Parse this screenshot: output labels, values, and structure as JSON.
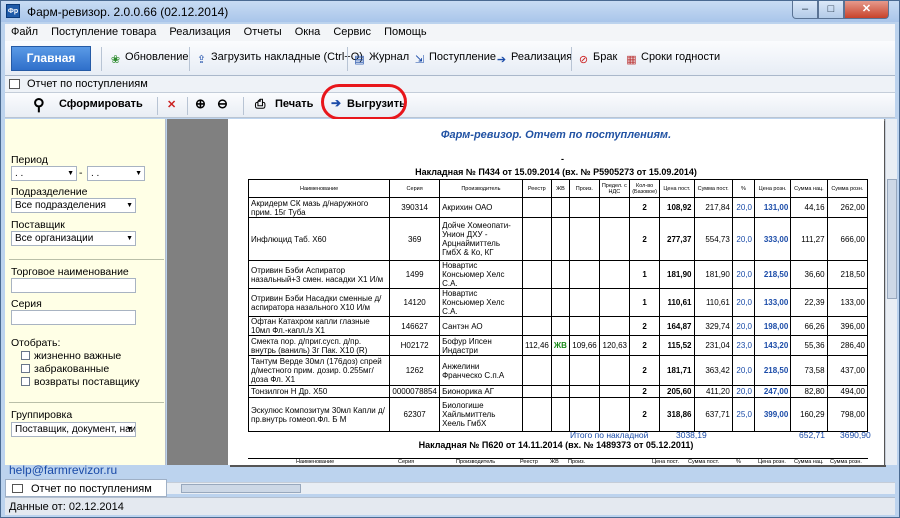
{
  "window": {
    "title": "Фарм-ревизор. 2.0.0.66 (02.12.2014)",
    "app_icon": "Фр"
  },
  "menu": [
    "Файл",
    "Поступление товара",
    "Реализация",
    "Отчеты",
    "Окна",
    "Сервис",
    "Помощь"
  ],
  "ribbon": {
    "main": "Главная",
    "items": [
      {
        "icon": "refresh-icon",
        "label": "Обновление"
      },
      {
        "icon": "import-icon",
        "label": "Загрузить накладные (Ctrl+O)"
      },
      {
        "icon": "journal-icon",
        "label": "Журнал"
      },
      {
        "icon": "receipt-icon",
        "label": "Поступление"
      },
      {
        "icon": "sale-icon",
        "label": "Реализация"
      },
      {
        "icon": "reject-icon",
        "label": "Брак"
      },
      {
        "icon": "calendar-icon",
        "label": "Сроки годности"
      }
    ]
  },
  "doc_header": "Отчет по поступлениям",
  "toolbar": {
    "generate": "Сформировать",
    "print": "Печать",
    "export": "Выгрузить"
  },
  "filters": {
    "period_label": "Период",
    "period_from": ". .",
    "period_to": ". .",
    "division_label": "Подразделение",
    "division_value": "Все подразделения",
    "supplier_label": "Поставщик",
    "supplier_value": "Все организации",
    "trade_name_label": "Торговое наименование",
    "series_label": "Серия",
    "select_label": "Отобрать:",
    "checks": [
      "жизненно важные",
      "забракованные",
      "возвраты поставщику"
    ],
    "grouping_label": "Группировка",
    "grouping_value": "Поставщик, документ, наи"
  },
  "email": "help@farmrevizor.ru",
  "report": {
    "title": "Фарм-ревизор. Отчет по поступлениям.",
    "dot": "-",
    "invoice1": "Накладная № П434 от 15.09.2014 (вх. № Р5905273 от 15.09.2014)",
    "invoice2": "Накладная № П620 от 14.11.2014 (вх. № 1489373 от 05.12.2011)",
    "headers": [
      "Наименование",
      "Серия",
      "Производитель",
      "Реестр",
      "ЖВ",
      "Произ.",
      "Предел. с НДС",
      "Кол-во (Базовое)",
      "Цена пост.",
      "Сумма пост.",
      "%",
      "Цена розн.",
      "Сумма нац.",
      "Сумма розн."
    ],
    "rows": [
      [
        "Акридерм СК мазь д/наружного прим. 15г Туба",
        "390314",
        "Акрихин ОАО",
        "",
        "",
        "",
        "",
        "2",
        "108,92",
        "217,84",
        "20,0",
        "131,00",
        "44,16",
        "262,00"
      ],
      [
        "Инфлюцид Таб. Х60",
        "369",
        "Дойче Хомеопати-Унион ДХУ - Арцнаймиттель ГмбХ & Ко, КГ",
        "",
        "",
        "",
        "",
        "2",
        "277,37",
        "554,73",
        "20,0",
        "333,00",
        "111,27",
        "666,00"
      ],
      [
        "Отривин Бэби Аспиратор назальный+3 смен. насадки Х1 И/м",
        "1499",
        "Новартис Консьюмер Хелс С.А.",
        "",
        "",
        "",
        "",
        "1",
        "181,90",
        "181,90",
        "20,0",
        "218,50",
        "36,60",
        "218,50"
      ],
      [
        "Отривин Бэби Насадки сменные д/аспиратора назального Х10 И/м",
        "14120",
        "Новартис Консьюмер Хелс С.А.",
        "",
        "",
        "",
        "",
        "1",
        "110,61",
        "110,61",
        "20,0",
        "133,00",
        "22,39",
        "133,00"
      ],
      [
        "Офтан Катахром капли глазные 10мл Фл.-капл./з Х1",
        "146627",
        "Сантэн АО",
        "",
        "",
        "",
        "",
        "2",
        "164,87",
        "329,74",
        "20,0",
        "198,00",
        "66,26",
        "396,00"
      ],
      [
        "Смекта пор. д/приг.сусп. д/пр. внутрь (ваниль) 3г Пак. Х10 (R)",
        "Н02172",
        "Бофур Ипсен Индастри",
        "112,46",
        "ЖВ",
        "109,66",
        "120,63",
        "2",
        "115,52",
        "231,04",
        "23,0",
        "143,20",
        "55,36",
        "286,40"
      ],
      [
        "Тантум Верде 30мл (176доз) спрей д/местного прим. дозир. 0.255мг/доза Фл. Х1",
        "1262",
        "Анжелини Франческо С.п.А",
        "",
        "",
        "",
        "",
        "2",
        "181,71",
        "363,42",
        "20,0",
        "218,50",
        "73,58",
        "437,00"
      ],
      [
        "Тонзилгон Н Др. Х50",
        "0000078854",
        "Бионорика АГ",
        "",
        "",
        "",
        "",
        "2",
        "205,60",
        "411,20",
        "20,0",
        "247,00",
        "82,80",
        "494,00"
      ],
      [
        "Эскулюс Композитум 30мл Капли д/пр.внутрь гомеоп.Фл. Б М",
        "62307",
        "Биологише Хайльмиттель Хеель ГмбХ",
        "",
        "",
        "",
        "",
        "2",
        "318,86",
        "637,71",
        "25,0",
        "399,00",
        "160,29",
        "798,00"
      ]
    ],
    "total_label": "Итого по накладной",
    "total_sum": "3038,19",
    "total_nat": "652,71",
    "total_retail": "3690,90"
  },
  "tab": "Отчет по поступлениям",
  "status": "Данные от: 02.12.2014"
}
